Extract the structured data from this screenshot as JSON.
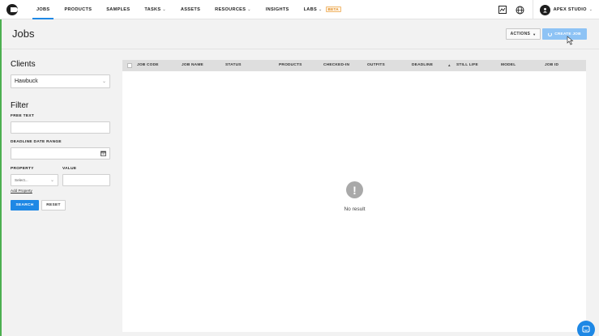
{
  "nav": {
    "items": [
      {
        "label": "JOBS",
        "active": true,
        "caret": false,
        "badge": ""
      },
      {
        "label": "PRODUCTS",
        "active": false,
        "caret": false,
        "badge": ""
      },
      {
        "label": "SAMPLES",
        "active": false,
        "caret": false,
        "badge": ""
      },
      {
        "label": "TASKS",
        "active": false,
        "caret": true,
        "badge": ""
      },
      {
        "label": "ASSETS",
        "active": false,
        "caret": false,
        "badge": ""
      },
      {
        "label": "RESOURCES",
        "active": false,
        "caret": true,
        "badge": ""
      },
      {
        "label": "INSIGHTS",
        "active": false,
        "caret": false,
        "badge": ""
      },
      {
        "label": "LABS",
        "active": false,
        "caret": true,
        "badge": "BETA"
      }
    ],
    "right": {
      "icons": [
        "chart-icon",
        "globe-icon"
      ],
      "studio_name": "APEX STUDIO"
    }
  },
  "header": {
    "title": "Jobs",
    "actions_label": "ACTIONS",
    "create_label": "CREATE JOB"
  },
  "filters": {
    "clients_heading": "Clients",
    "client_value": "Hawbuck",
    "filter_heading": "Filter",
    "free_text_label": "FREE TEXT",
    "deadline_label": "DEADLINE DATE RANGE",
    "property_label": "PROPERTY",
    "value_label": "VALUE",
    "property_placeholder": "Select...",
    "add_property": "Add Property",
    "search_label": "SEARCH",
    "reset_label": "RESET"
  },
  "table": {
    "columns": [
      "JOB CODE",
      "JOB NAME",
      "STATUS",
      "PRODUCTS",
      "CHECKED-IN",
      "OUTFITS",
      "DEADLINE",
      "STILL LIFE",
      "MODEL",
      "JOB ID"
    ],
    "sorted_column": "DEADLINE",
    "empty_text": "No result"
  },
  "colors": {
    "accent": "#1e88e5",
    "create_disabled": "#8ec3f5",
    "beta": "#e08a1e"
  }
}
